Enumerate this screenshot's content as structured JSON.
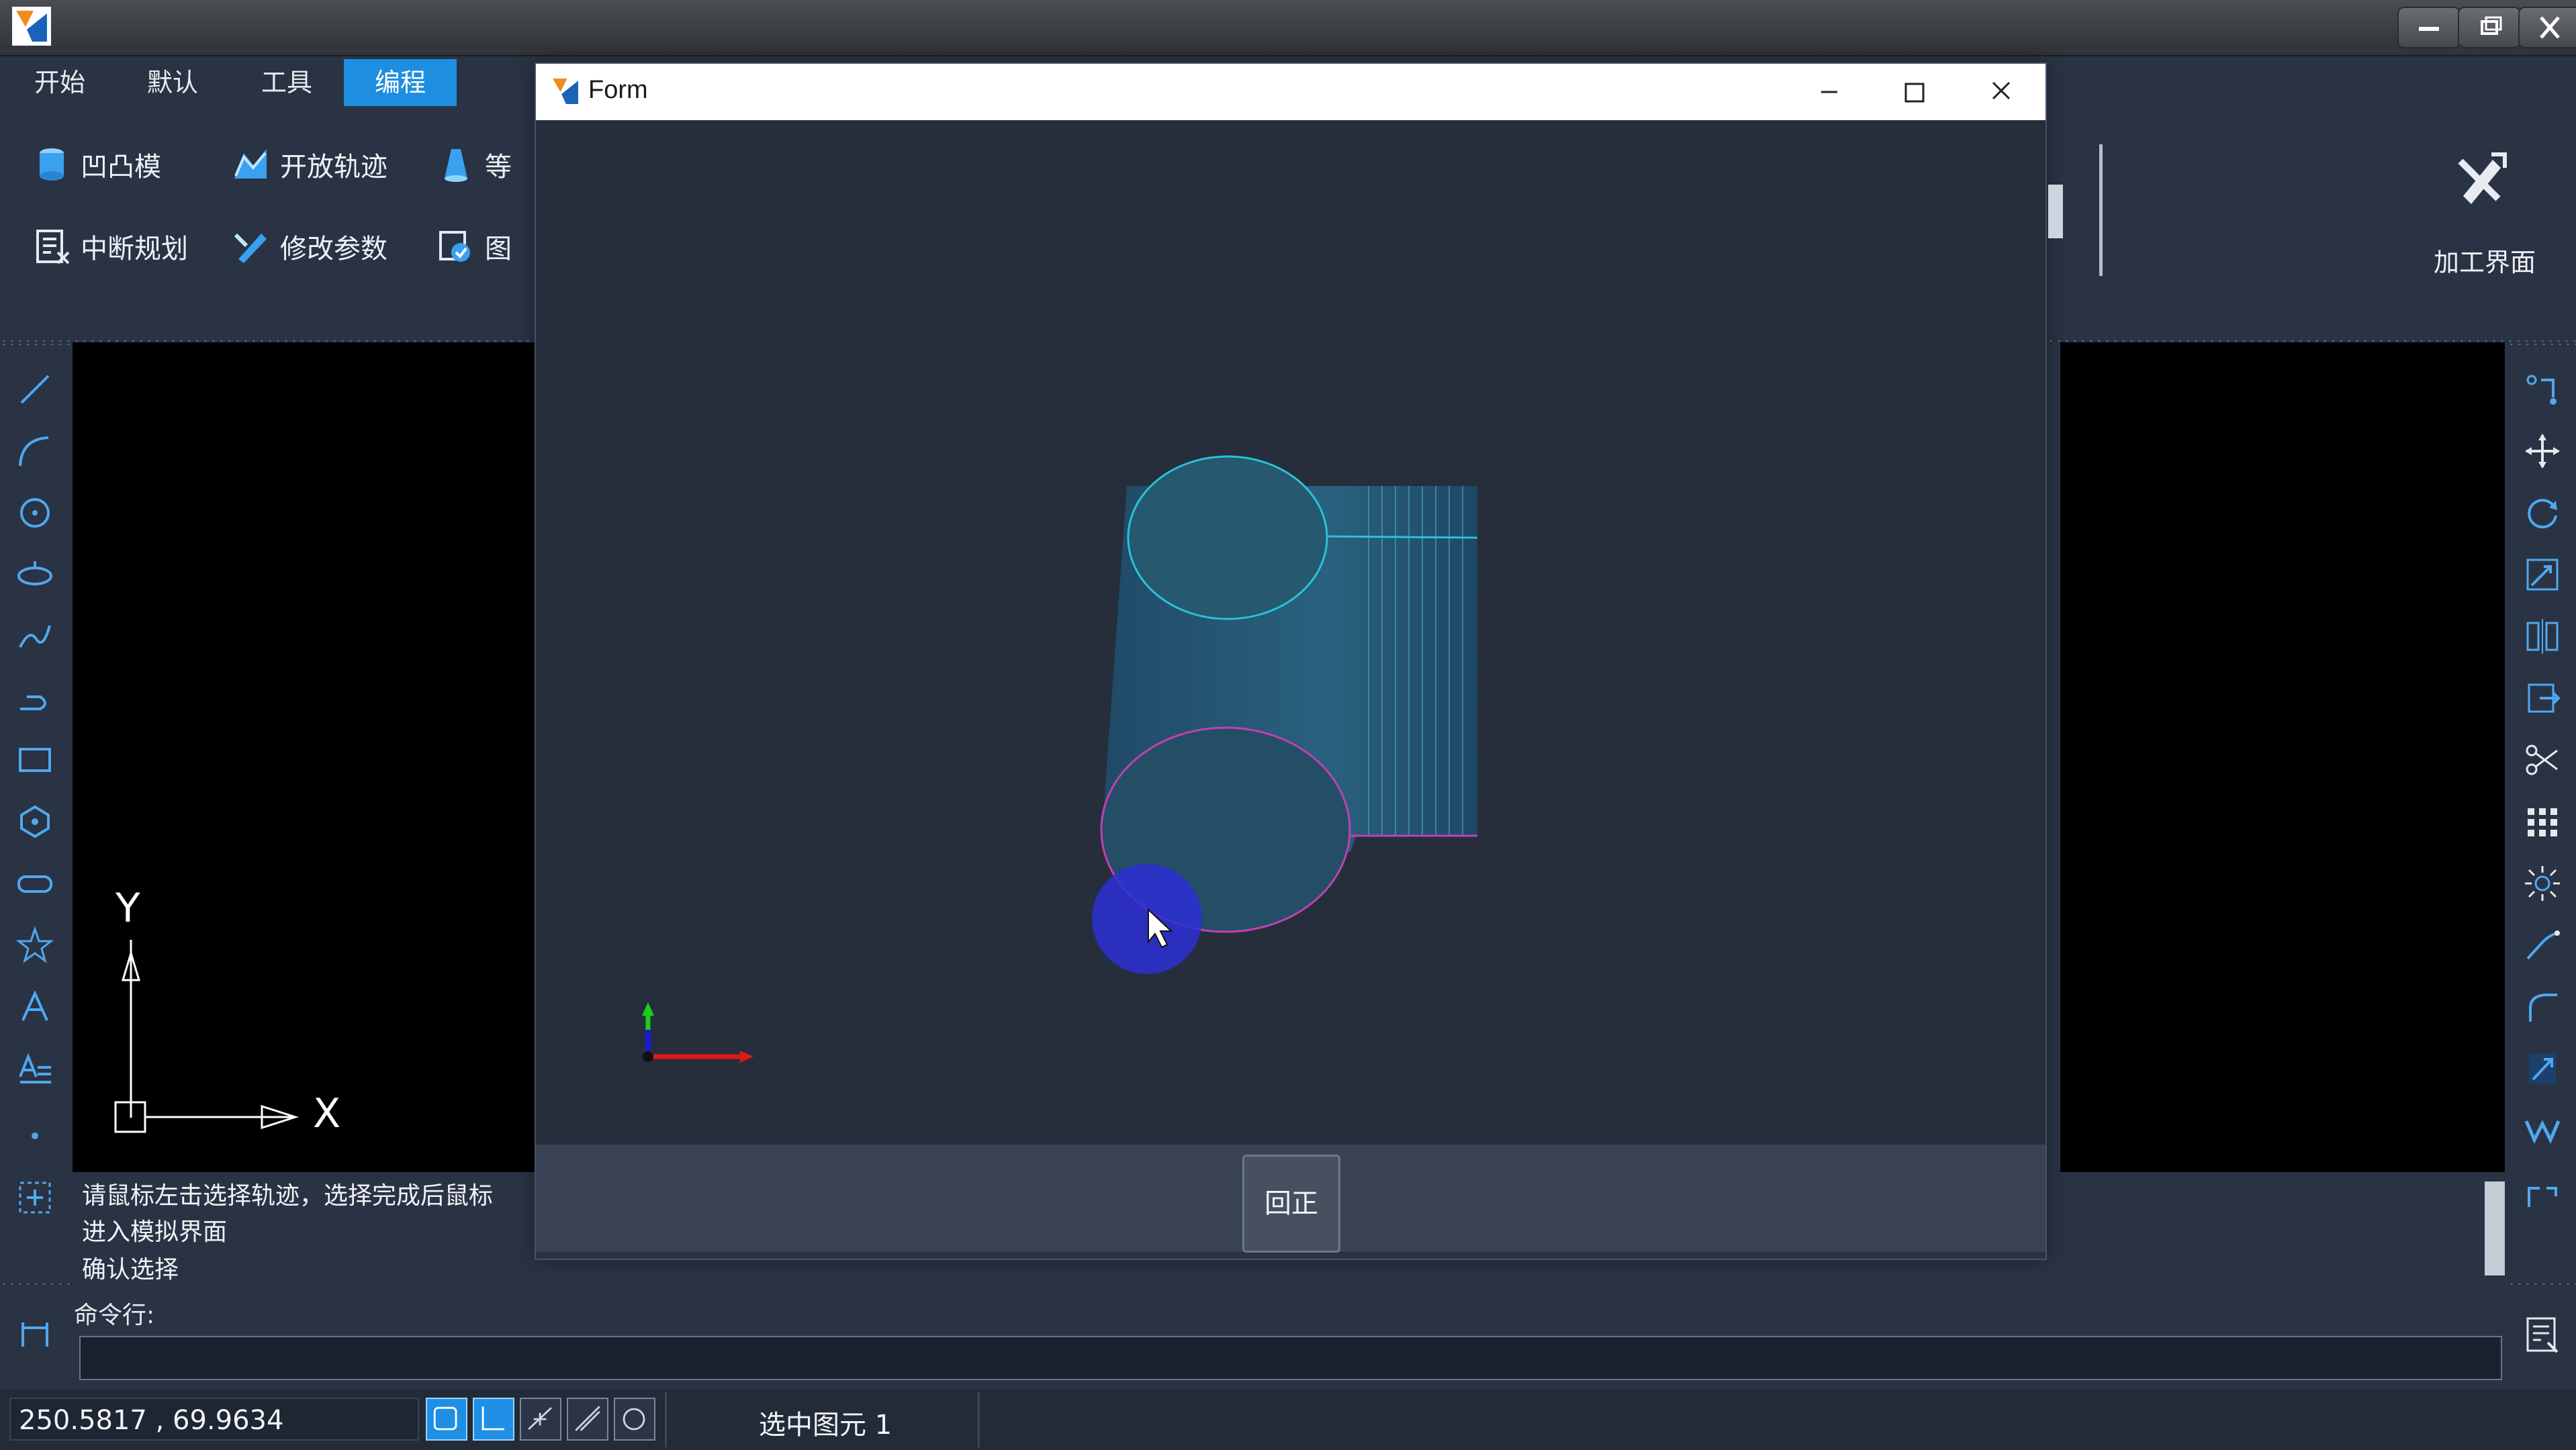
{
  "app": {
    "icon": "app-logo-icon"
  },
  "window_controls": [
    "minimize-icon",
    "restore-icon",
    "close-icon"
  ],
  "menu": {
    "tabs": [
      "开始",
      "默认",
      "工具",
      "编程"
    ],
    "active": "编程"
  },
  "ribbon": {
    "row1": [
      {
        "label": "凹凸模",
        "icon": "cylinder-icon"
      },
      {
        "label": "开放轨迹",
        "icon": "open-path-icon"
      },
      {
        "label": "等",
        "icon": "cone-icon"
      }
    ],
    "row2": [
      {
        "label": "中断规划",
        "icon": "interrupt-plan-icon"
      },
      {
        "label": "修改参数",
        "icon": "modify-params-icon"
      },
      {
        "label": "图",
        "icon": "image-check-icon"
      }
    ],
    "machining": {
      "label": "加工界面",
      "icon": "machining-tools-icon"
    }
  },
  "axes": {
    "x": "X",
    "y": "Y"
  },
  "messages": [
    "请鼠标左击选择轨迹，选择完成后鼠标",
    "进入模拟界面",
    "确认选择"
  ],
  "command": {
    "label": "命令行:",
    "value": ""
  },
  "status": {
    "coords": "250.5817 , 69.9634",
    "selected": "选中图元 1"
  },
  "form": {
    "title": "Form",
    "reset_button": "回正"
  },
  "colors": {
    "accent": "#1e8fe0",
    "cyan_outline": "#27c3d8",
    "magenta_outline": "#c23fb3",
    "cursor_highlight": "#2b2fd4"
  }
}
